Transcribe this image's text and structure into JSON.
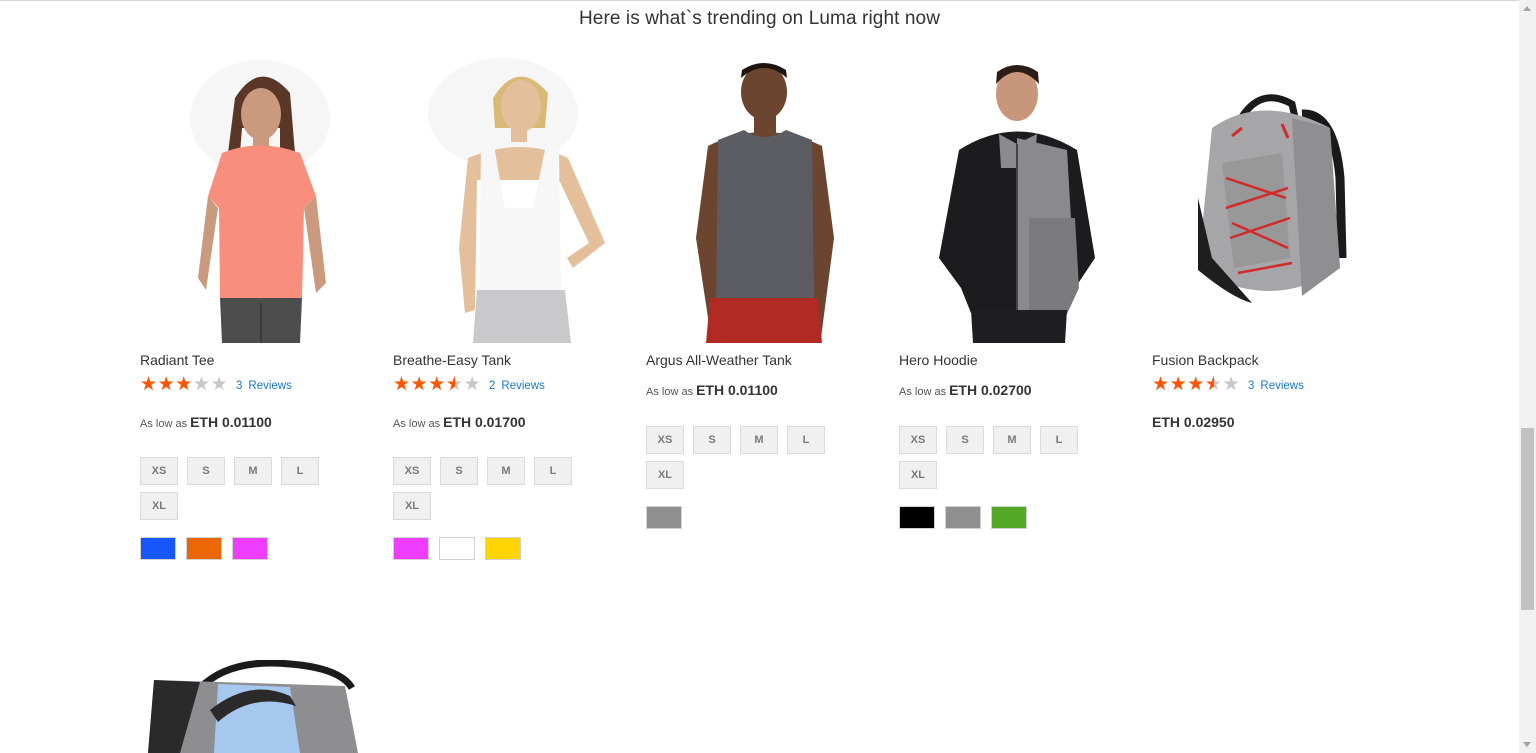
{
  "heading": "Here is what`s trending on Luma right now",
  "products": [
    {
      "name": "Radiant Tee",
      "rating_fraction": 0.6,
      "reviews_count": "3",
      "reviews_label": "Reviews",
      "price_prefix": "As low as",
      "price": "ETH 0.01100",
      "sizes": [
        "XS",
        "S",
        "M",
        "L",
        "XL"
      ],
      "colors": [
        "#1857f7",
        "#eb6703",
        "#ef3dff"
      ]
    },
    {
      "name": "Breathe-Easy Tank",
      "rating_fraction": 0.7,
      "reviews_count": "2",
      "reviews_label": "Reviews",
      "price_prefix": "As low as",
      "price": "ETH 0.01700",
      "sizes": [
        "XS",
        "S",
        "M",
        "L",
        "XL"
      ],
      "colors": [
        "#ef3dff",
        "#ffffff",
        "#ffd500"
      ]
    },
    {
      "name": "Argus All-Weather Tank",
      "price_prefix": "As low as",
      "price": "ETH 0.01100",
      "sizes": [
        "XS",
        "S",
        "M",
        "L",
        "XL"
      ],
      "colors": [
        "#8f8f8f"
      ]
    },
    {
      "name": "Hero Hoodie",
      "price_prefix": "As low as",
      "price": "ETH 0.02700",
      "sizes": [
        "XS",
        "S",
        "M",
        "L",
        "XL"
      ],
      "colors": [
        "#000000",
        "#8f8f8f",
        "#53a828"
      ]
    },
    {
      "name": "Fusion Backpack",
      "rating_fraction": 0.7,
      "reviews_count": "3",
      "reviews_label": "Reviews",
      "price": "ETH 0.02950"
    }
  ],
  "icons": {
    "star": "★",
    "scroll_up": "scroll-up-arrow-icon",
    "scroll_down": "scroll-down-arrow-icon"
  }
}
